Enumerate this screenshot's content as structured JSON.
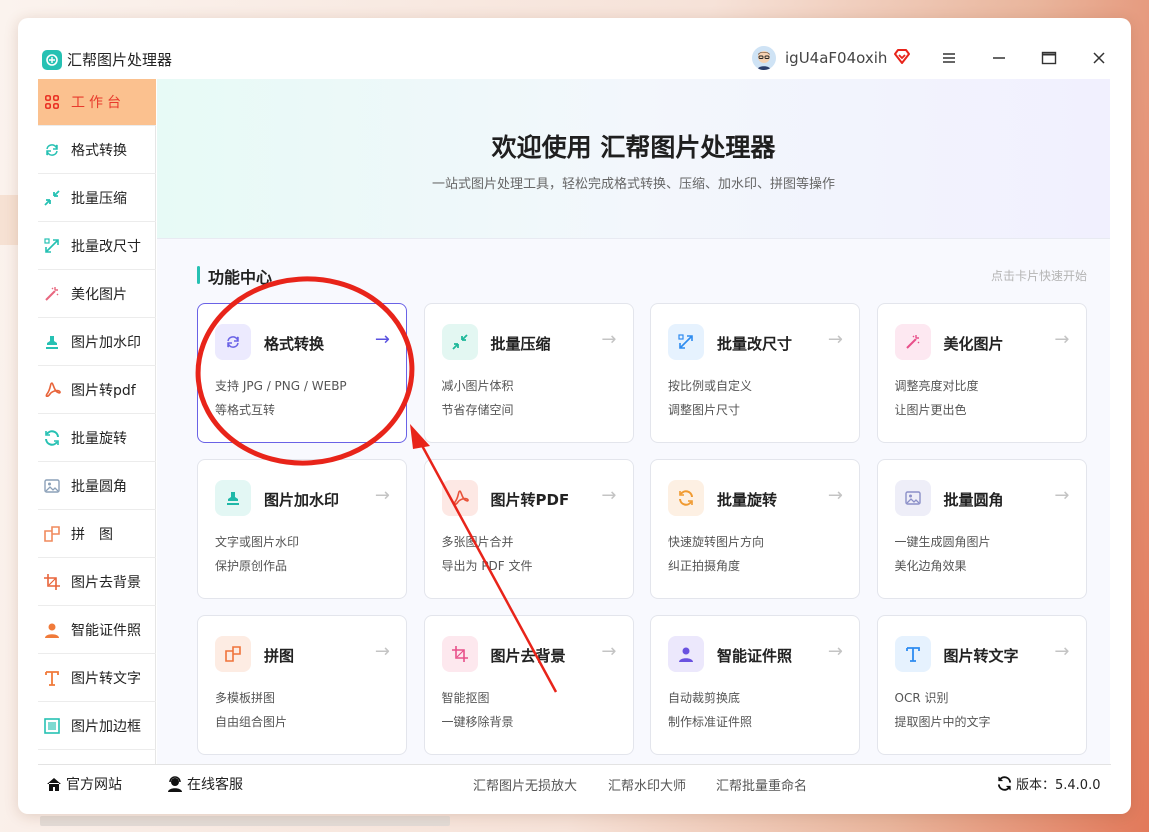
{
  "app": {
    "title": "汇帮图片处理器",
    "username": "igU4aF04oxih"
  },
  "colors": {
    "accent": "#26c1b3",
    "active_bg": "#fbc18f",
    "active_text": "#e83a2c",
    "highlight_border": "#6a62e6",
    "annotation_red": "#e8241a"
  },
  "sidebar": {
    "items": [
      {
        "label": "工作台",
        "icon": "grid-icon",
        "active": true
      },
      {
        "label": "格式转换",
        "icon": "convert-icon"
      },
      {
        "label": "批量压缩",
        "icon": "compress-icon"
      },
      {
        "label": "批量改尺寸",
        "icon": "resize-icon"
      },
      {
        "label": "美化图片",
        "icon": "magic-wand-icon"
      },
      {
        "label": "图片加水印",
        "icon": "stamp-icon"
      },
      {
        "label": "图片转pdf",
        "icon": "pdf-icon"
      },
      {
        "label": "批量旋转",
        "icon": "rotate-icon"
      },
      {
        "label": "批量圆角",
        "icon": "image-icon"
      },
      {
        "label": "拼　图",
        "icon": "puzzle-icon"
      },
      {
        "label": "图片去背景",
        "icon": "crop-icon"
      },
      {
        "label": "智能证件照",
        "icon": "person-icon"
      },
      {
        "label": "图片转文字",
        "icon": "text-icon"
      },
      {
        "label": "图片加边框",
        "icon": "frame-icon"
      }
    ]
  },
  "hero": {
    "title": "欢迎使用 汇帮图片处理器",
    "subtitle": "一站式图片处理工具，轻松完成格式转换、压缩、加水印、拼图等操作"
  },
  "section": {
    "title": "功能中心",
    "hint": "点击卡片快速开始"
  },
  "cards": [
    {
      "title": "格式转换",
      "desc1": "支持 JPG / PNG / WEBP",
      "desc2": "等格式互转",
      "icon": "convert-icon",
      "arrow": "→"
    },
    {
      "title": "批量压缩",
      "desc1": "减小图片体积",
      "desc2": "节省存储空间",
      "icon": "compress-icon",
      "arrow": "→"
    },
    {
      "title": "批量改尺寸",
      "desc1": "按比例或自定义",
      "desc2": "调整图片尺寸",
      "icon": "resize-icon",
      "arrow": "→"
    },
    {
      "title": "美化图片",
      "desc1": "调整亮度对比度",
      "desc2": "让图片更出色",
      "icon": "magic-wand-icon",
      "arrow": "→"
    },
    {
      "title": "图片加水印",
      "desc1": "文字或图片水印",
      "desc2": "保护原创作品",
      "icon": "stamp-icon",
      "arrow": "→"
    },
    {
      "title": "图片转PDF",
      "desc1": "多张图片合并",
      "desc2": "导出为 PDF 文件",
      "icon": "pdf-icon",
      "arrow": "→"
    },
    {
      "title": "批量旋转",
      "desc1": "快速旋转图片方向",
      "desc2": "纠正拍摄角度",
      "icon": "rotate-icon",
      "arrow": "→"
    },
    {
      "title": "批量圆角",
      "desc1": "一键生成圆角图片",
      "desc2": "美化边角效果",
      "icon": "image-icon",
      "arrow": "→"
    },
    {
      "title": "拼图",
      "desc1": "多模板拼图",
      "desc2": "自由组合图片",
      "icon": "puzzle-icon",
      "arrow": "→"
    },
    {
      "title": "图片去背景",
      "desc1": "智能抠图",
      "desc2": "一键移除背景",
      "icon": "crop-icon",
      "arrow": "→"
    },
    {
      "title": "智能证件照",
      "desc1": "自动裁剪换底",
      "desc2": "制作标准证件照",
      "icon": "person-icon",
      "arrow": "→"
    },
    {
      "title": "图片转文字",
      "desc1": "OCR 识别",
      "desc2": "提取图片中的文字",
      "icon": "text-icon",
      "arrow": "→"
    }
  ],
  "footer": {
    "website": "官方网站",
    "support": "在线客服",
    "links": [
      "汇帮图片无损放大",
      "汇帮水印大师",
      "汇帮批量重命名"
    ],
    "version": "版本：5.4.0.0"
  }
}
